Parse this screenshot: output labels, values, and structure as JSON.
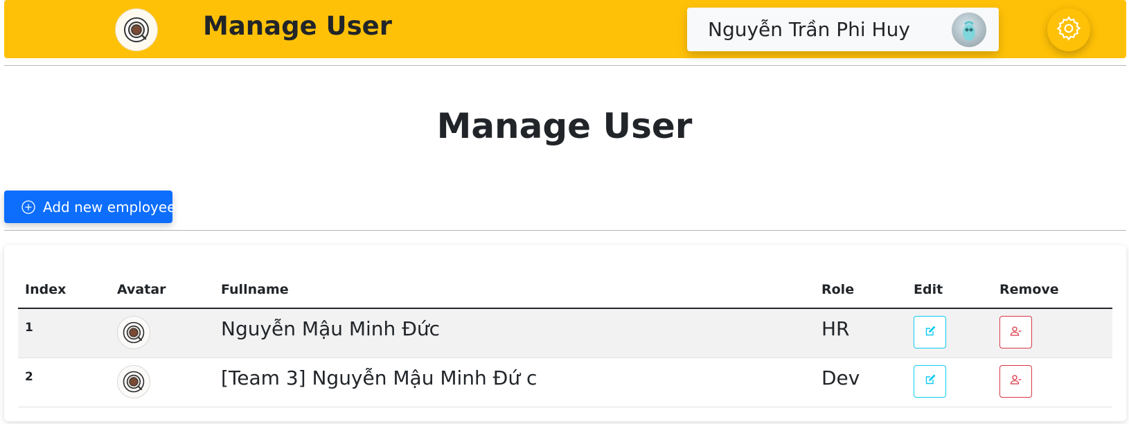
{
  "header": {
    "title": "Manage User",
    "user_name": "Nguyễn Trần Phi Huy",
    "logo_icon": "coffee-cup-icon",
    "settings_icon": "gear-icon",
    "accent_color": "#ffc107"
  },
  "main": {
    "title": "Manage User",
    "add_button_label": "Add new employee",
    "add_button_color": "#0d6efd"
  },
  "table": {
    "columns": [
      "Index",
      "Avatar",
      "Fullname",
      "Role",
      "Edit",
      "Remove"
    ],
    "rows": [
      {
        "index": "1",
        "fullname": "Nguyễn Mậu Minh Đức",
        "role": "HR"
      },
      {
        "index": "2",
        "fullname": "[Team 3] Nguyễn Mậu Minh Đứ c",
        "role": "Dev"
      }
    ],
    "edit_icon": "pencil-square-icon",
    "remove_icon": "person-dash-icon",
    "edit_color": "#0dcaf0",
    "remove_color": "#dc3545"
  }
}
